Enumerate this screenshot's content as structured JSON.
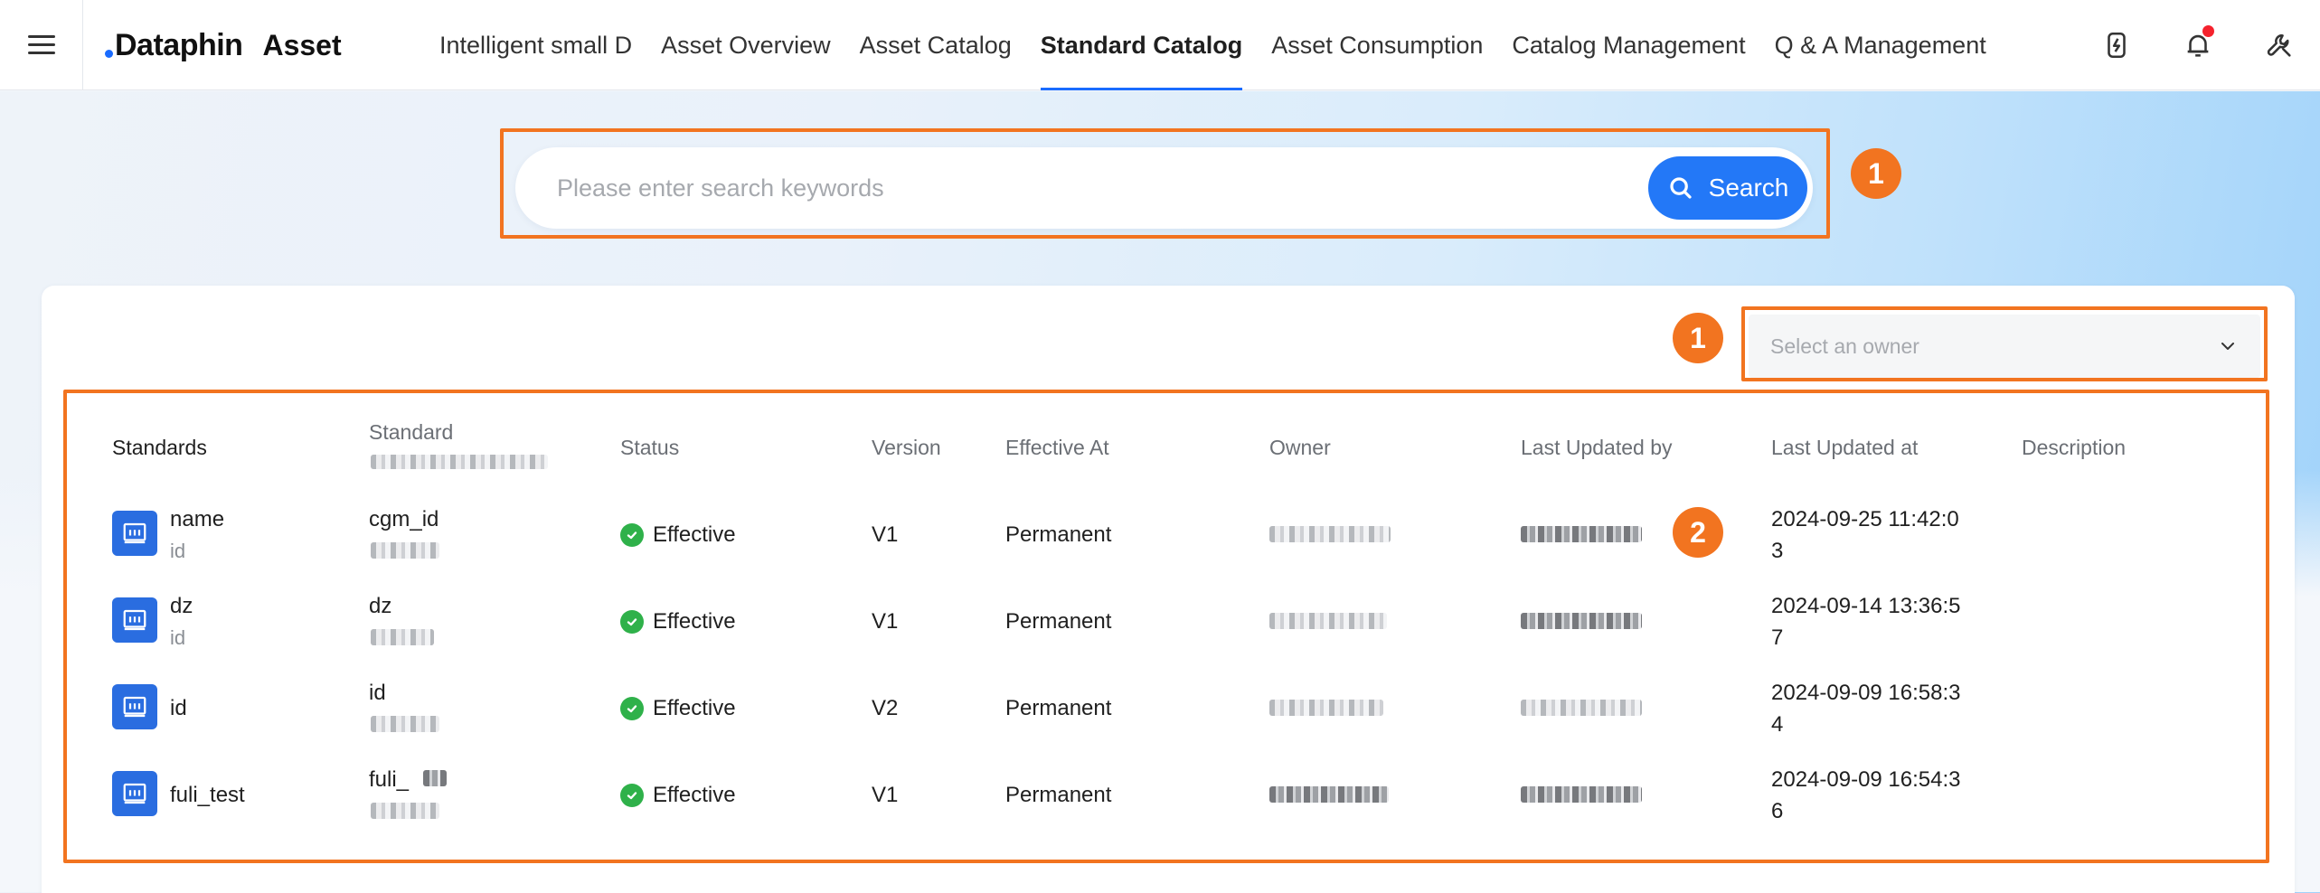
{
  "header": {
    "logo_text": "Dataphin",
    "product": "Asset",
    "tabs": [
      {
        "label": "Intelligent small D"
      },
      {
        "label": "Asset Overview"
      },
      {
        "label": "Asset Catalog"
      },
      {
        "label": "Standard Catalog",
        "active": true
      },
      {
        "label": "Asset Consumption"
      },
      {
        "label": "Catalog Management"
      },
      {
        "label": "Q & A Management"
      }
    ],
    "icons": [
      "power-icon",
      "bell-icon",
      "wrench-icon"
    ]
  },
  "search": {
    "placeholder": "Please enter search keywords",
    "button_label": "Search"
  },
  "annotations": {
    "badge_search": "1",
    "badge_owner": "1",
    "badge_table": "2"
  },
  "filter": {
    "owner_placeholder": "Select an owner"
  },
  "table": {
    "headers": {
      "standards": "Standards",
      "standard": "Standard",
      "status": "Status",
      "version": "Version",
      "effective_at": "Effective At",
      "owner": "Owner",
      "last_updated_by": "Last Updated by",
      "last_updated_at": "Last Updated at",
      "description": "Description"
    },
    "rows": [
      {
        "name": "name",
        "name_sub": "id",
        "standard": "cgm_id",
        "status": "Effective",
        "version": "V1",
        "effective_at": "Permanent",
        "updated_at_line1": "2024-09-25 11:42:0",
        "updated_at_line2": "3"
      },
      {
        "name": "dz",
        "name_sub": "id",
        "standard": "dz",
        "status": "Effective",
        "version": "V1",
        "effective_at": "Permanent",
        "updated_at_line1": "2024-09-14 13:36:5",
        "updated_at_line2": "7"
      },
      {
        "name": "id",
        "name_sub": "",
        "standard": "id",
        "status": "Effective",
        "version": "V2",
        "effective_at": "Permanent",
        "updated_at_line1": "2024-09-09 16:58:3",
        "updated_at_line2": "4"
      },
      {
        "name": "fuli_test",
        "name_sub": "",
        "standard": "fuli_",
        "status": "Effective",
        "version": "V1",
        "effective_at": "Permanent",
        "updated_at_line1": "2024-09-09 16:54:3",
        "updated_at_line2": "6"
      }
    ]
  },
  "colors": {
    "accent": "#2378f7",
    "annotation": "#f27420",
    "status_effective": "#2fb14a",
    "row_icon": "#2a6de0"
  }
}
